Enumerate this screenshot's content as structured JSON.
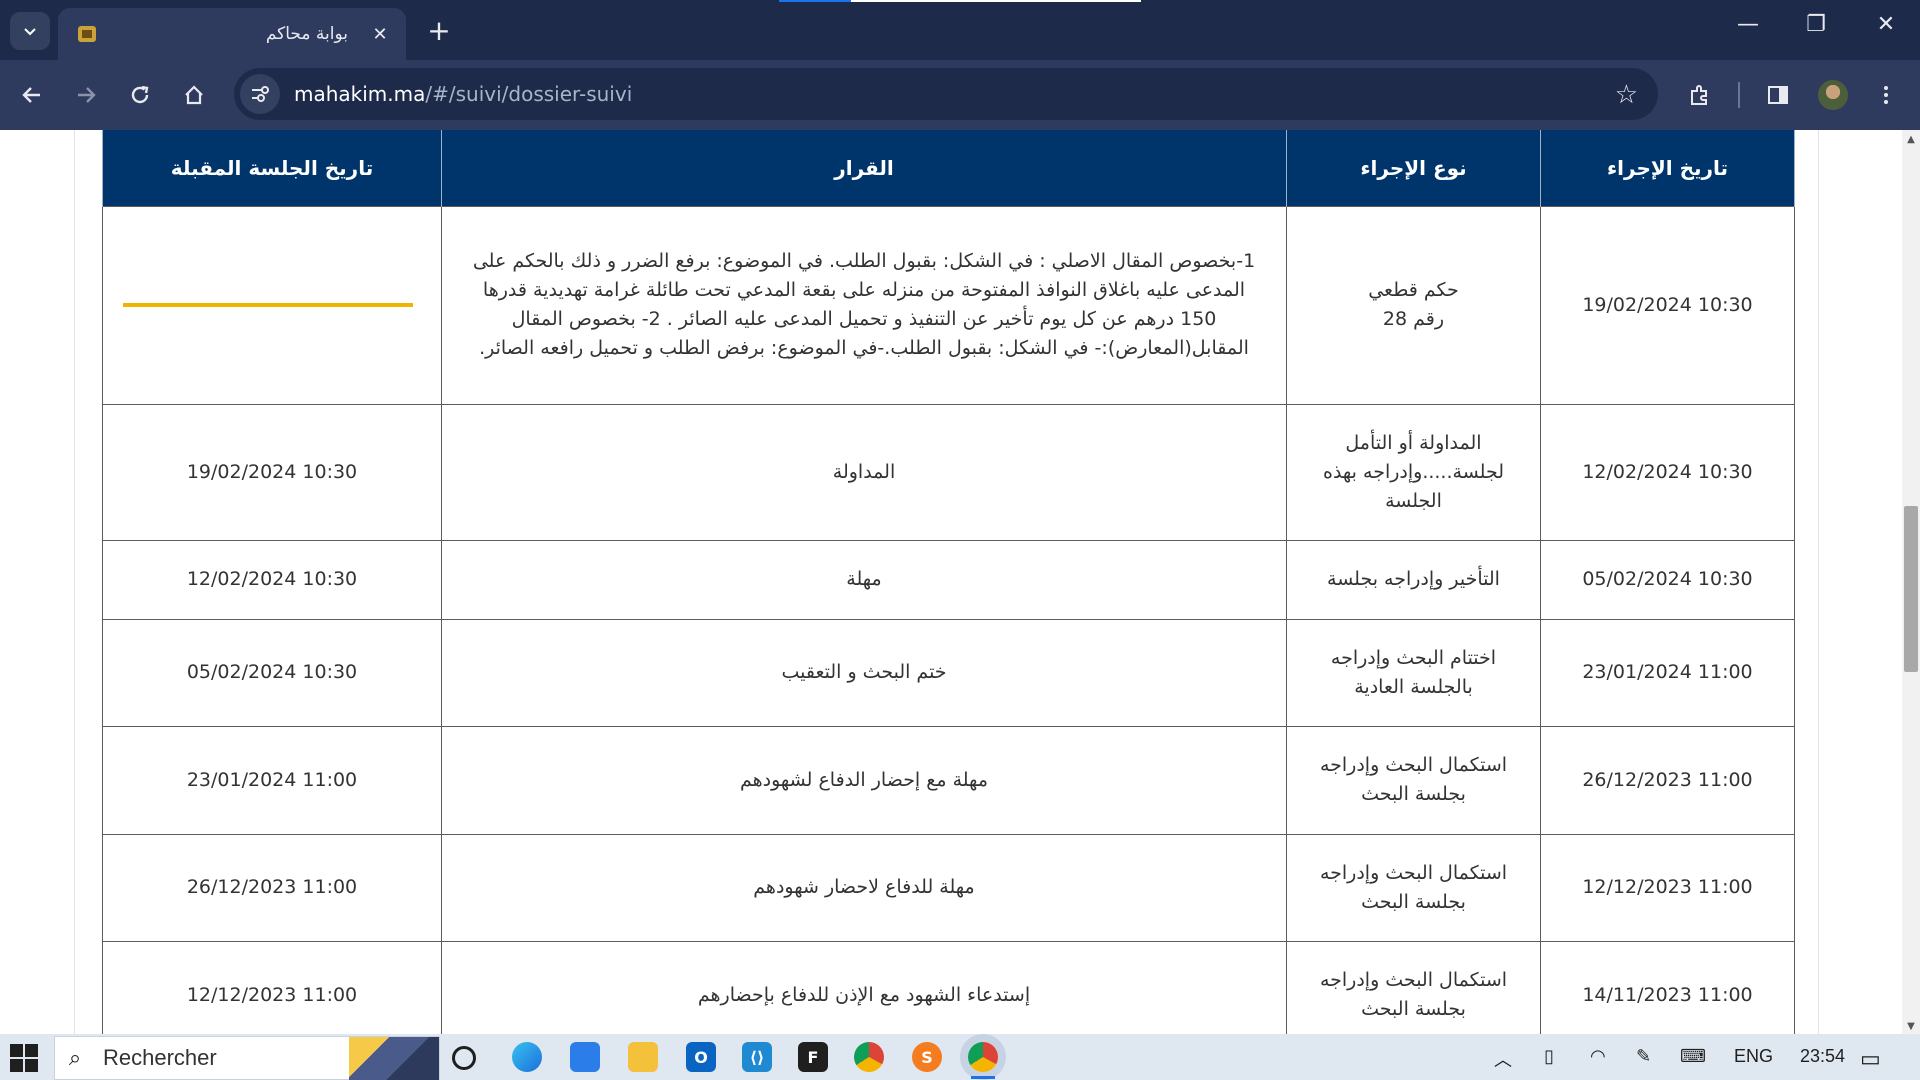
{
  "browser": {
    "tab_title": "بوابة محاكم",
    "url_host": "mahakim.ma",
    "url_path": "/#/suivi/dossier-suivi",
    "icons": [
      "tab-search-icon",
      "close-icon",
      "plus-icon",
      "minimize-icon",
      "restore-icon",
      "window-close-icon",
      "back-icon",
      "forward-icon",
      "reload-icon",
      "home-icon",
      "site-info-icon",
      "star-icon",
      "extensions-icon",
      "side-panel-icon",
      "profile-avatar",
      "menu-icon"
    ]
  },
  "table": {
    "headers": {
      "date": "تاريخ الإجراء",
      "type": "نوع الإجراء",
      "decision": "القرار",
      "next": "تاريخ الجلسة المقبلة"
    },
    "rows": [
      {
        "date": "19/02/2024 10:30",
        "type_line1": "حكم قطعي",
        "type_line2": "رقم 28",
        "decision": "1-بخصوص المقال الاصلي : في الشكل: بقبول الطلب. في الموضوع: برفع الضرر و ذلك بالحكم على المدعى عليه باغلاق النوافذ المفتوحة من منزله على بقعة المدعي تحت طائلة غرامة تهديدية قدرها 150 درهم عن كل يوم تأخير عن التنفيذ و تحميل المدعى عليه الصائر . 2- بخصوص المقال المقابل(المعارض):- في الشكل: بقبول الطلب.-في الموضوع: برفض الطلب و تحميل رافعه الصائر.",
        "next": ""
      },
      {
        "date": "12/02/2024 10:30",
        "type_line1": "المداولة أو التأمل",
        "type_line2": "لجلسة.....وإدراجه بهذه",
        "type_line3": "الجلسة",
        "decision": "المداولة",
        "next": "19/02/2024 10:30"
      },
      {
        "date": "05/02/2024 10:30",
        "type_line1": "التأخير وإدراجه بجلسة",
        "decision": "مهلة",
        "next": "12/02/2024 10:30"
      },
      {
        "date": "23/01/2024 11:00",
        "type_line1": "اختتام البحث وإدراجه",
        "type_line2": "بالجلسة العادية",
        "decision": "ختم البحث و التعقيب",
        "next": "05/02/2024 10:30"
      },
      {
        "date": "26/12/2023 11:00",
        "type_line1": "استكمال البحث وإدراجه",
        "type_line2": "بجلسة البحث",
        "decision": "مهلة مع إحضار الدفاع لشهودهم",
        "next": "23/01/2024 11:00"
      },
      {
        "date": "12/12/2023 11:00",
        "type_line1": "استكمال البحث وإدراجه",
        "type_line2": "بجلسة البحث",
        "decision": "مهلة للدفاع لاحضار شهودهم",
        "next": "26/12/2023 11:00"
      },
      {
        "date": "14/11/2023 11:00",
        "type_line1": "استكمال البحث وإدراجه",
        "type_line2": "بجلسة البحث",
        "decision": "إستدعاء الشهود مع الإذن للدفاع بإحضارهم",
        "next": "12/12/2023 11:00"
      }
    ],
    "pending_bar_color": "#f0b400",
    "header_color": "#00356b"
  },
  "taskbar": {
    "search_placeholder": "Rechercher",
    "language": "ENG",
    "time": "23:54",
    "apps": [
      "task-view-icon",
      "edge-icon",
      "store-icon",
      "file-explorer-icon",
      "outlook-icon",
      "vscode-icon",
      "figma-icon",
      "chrome-icon",
      "sublime-icon",
      "chrome-active-icon"
    ]
  }
}
